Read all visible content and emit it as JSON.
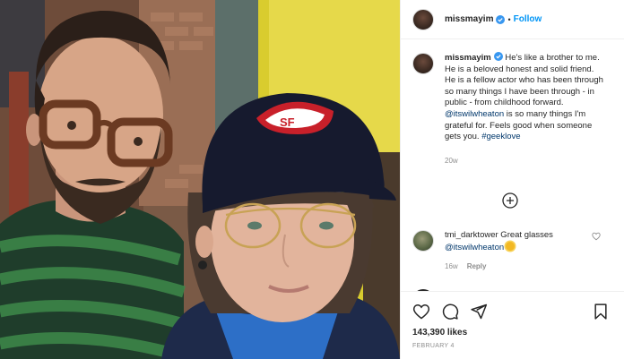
{
  "post": {
    "author": "missmayim",
    "follow_label": "Follow",
    "separator": "•"
  },
  "caption": {
    "username": "missmayim",
    "text_part1": " He's like a brother to me. He is a beloved honest and solid friend. He is a fellow actor who has been through so many things I have been through - in public - from childhood forward. ",
    "mention": "@itswilwheaton",
    "text_part2": " is so many things I'm grateful for. Feels good when someone gets you. ",
    "hashtag": "#geeklove",
    "time": "20w"
  },
  "comment": {
    "username": "tmi_darktower",
    "text": " Great glasses ",
    "mention": "@itswilwheaton",
    "emoji": "sun-emoji",
    "time": "16w",
    "reply_label": "Reply"
  },
  "likes": "143,390 likes",
  "date": "FEBRUARY 4",
  "cap_logo_text": "SF",
  "icons": [
    "verified-badge-icon",
    "add-circle-icon",
    "heart-icon",
    "comment-icon",
    "share-icon",
    "bookmark-icon"
  ],
  "colors": {
    "link": "#00376b",
    "follow": "#0095f6",
    "verified": "#3897f0",
    "meta": "#8e8e8e"
  }
}
